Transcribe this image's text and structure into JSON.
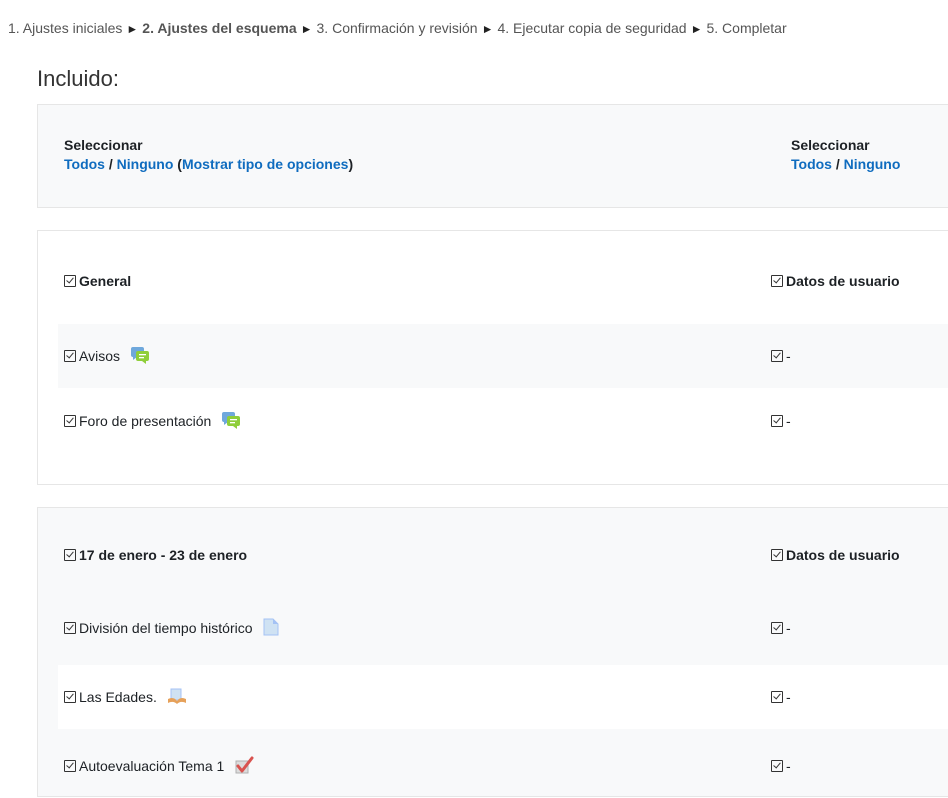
{
  "breadcrumb": {
    "step1": "1. Ajustes iniciales",
    "step2": "2. Ajustes del esquema",
    "step3": "3. Confirmación y revisión",
    "step4": "4. Ejecutar copia de seguridad",
    "step5": "5. Completar",
    "separator": "►"
  },
  "heading": "Incluido:",
  "select_left": {
    "label": "Seleccionar",
    "all": "Todos",
    "slash": " / ",
    "none": "Ninguno",
    "open_paren": " (",
    "show_types": "Mostrar tipo de opciones",
    "close_paren": ")"
  },
  "select_right": {
    "label": "Seleccionar",
    "all": "Todos",
    "slash": " / ",
    "none": "Ninguno"
  },
  "sections": [
    {
      "title": "General",
      "userdata": "Datos de usuario",
      "items": [
        {
          "label": "Avisos",
          "icon": "forum-icon",
          "userdata": "-"
        },
        {
          "label": "Foro de presentación",
          "icon": "forum-icon",
          "userdata": "-"
        }
      ]
    },
    {
      "title": "17 de enero - 23 de enero",
      "userdata": "Datos de usuario",
      "items": [
        {
          "label": "División del tiempo histórico",
          "icon": "page-icon",
          "userdata": "-"
        },
        {
          "label": "Las Edades.",
          "icon": "book-icon",
          "userdata": "-"
        },
        {
          "label": "Autoevaluación Tema 1",
          "icon": "quiz-icon",
          "userdata": "-"
        }
      ]
    }
  ],
  "colors": {
    "link": "#0f6cbf",
    "panel_bg": "#f8f9fa",
    "border": "#e6e6e6"
  }
}
